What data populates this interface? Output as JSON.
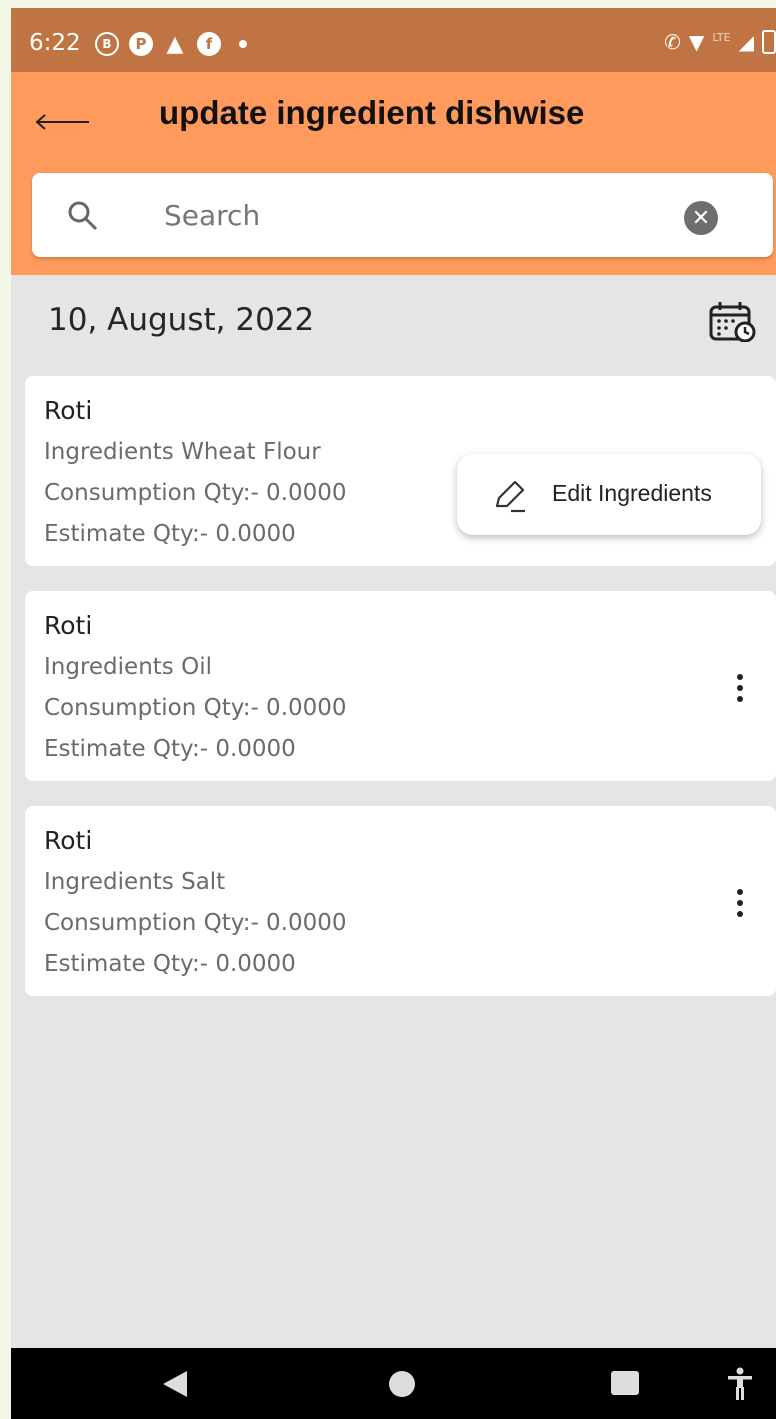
{
  "status_bar": {
    "time": "6:22",
    "left_icons": [
      "b-circle-icon",
      "p-circle-icon",
      "triangle-app-icon",
      "facebook-icon",
      "dot-icon"
    ],
    "right_icons": [
      "wifi-calling-icon",
      "wifi-icon",
      "lte-icon",
      "signal-icon",
      "battery-icon"
    ],
    "lte_label": "LTE"
  },
  "header": {
    "title": "update ingredient dishwise",
    "background_color": "#ff9a5c"
  },
  "search": {
    "placeholder": "Search",
    "value": ""
  },
  "date": "10, August, 2022",
  "cards": [
    {
      "dish": "Roti",
      "ingredient": "Ingredients Wheat Flour",
      "consumption": "Consumption Qty:- 0.0000",
      "estimate": "Estimate Qty:- 0.0000"
    },
    {
      "dish": "Roti",
      "ingredient": "Ingredients Oil",
      "consumption": "Consumption Qty:- 0.0000",
      "estimate": "Estimate Qty:- 0.0000"
    },
    {
      "dish": "Roti",
      "ingredient": "Ingredients Salt",
      "consumption": "Consumption Qty:- 0.0000",
      "estimate": "Estimate Qty:- 0.0000"
    }
  ],
  "popup_menu": {
    "edit_label": "Edit Ingredients"
  },
  "nav_bar": {
    "icons": [
      "back-icon",
      "home-icon",
      "recents-icon",
      "accessibility-icon"
    ]
  }
}
